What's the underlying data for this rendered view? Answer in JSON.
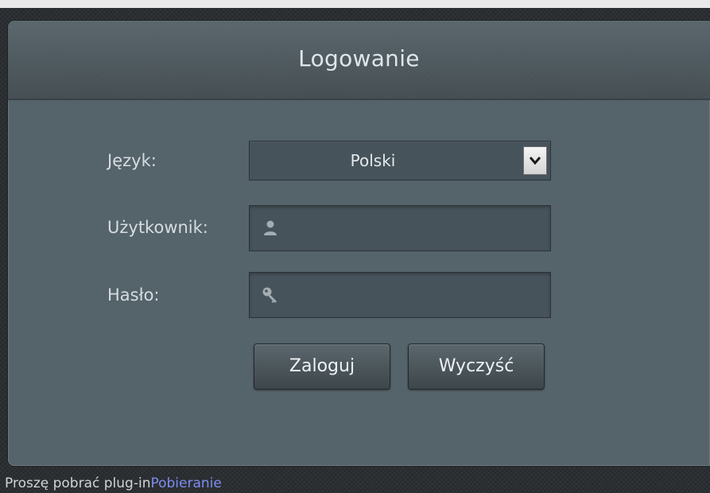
{
  "panel": {
    "title": "Logowanie"
  },
  "form": {
    "language_label": "Język:",
    "language_value": "Polski",
    "username_label": "Użytkownik:",
    "username_value": "",
    "password_label": "Hasło:",
    "password_value": ""
  },
  "buttons": {
    "login": "Zaloguj",
    "clear": "Wyczyść"
  },
  "footer": {
    "message": "Proszę pobrać plug-in",
    "download_link": "Pobieranie"
  },
  "icons": {
    "language_dropdown": "chevron-down-icon",
    "username": "user-icon",
    "password": "key-icon"
  },
  "colors": {
    "panel": "#55636a",
    "link": "#7d8cf0"
  }
}
